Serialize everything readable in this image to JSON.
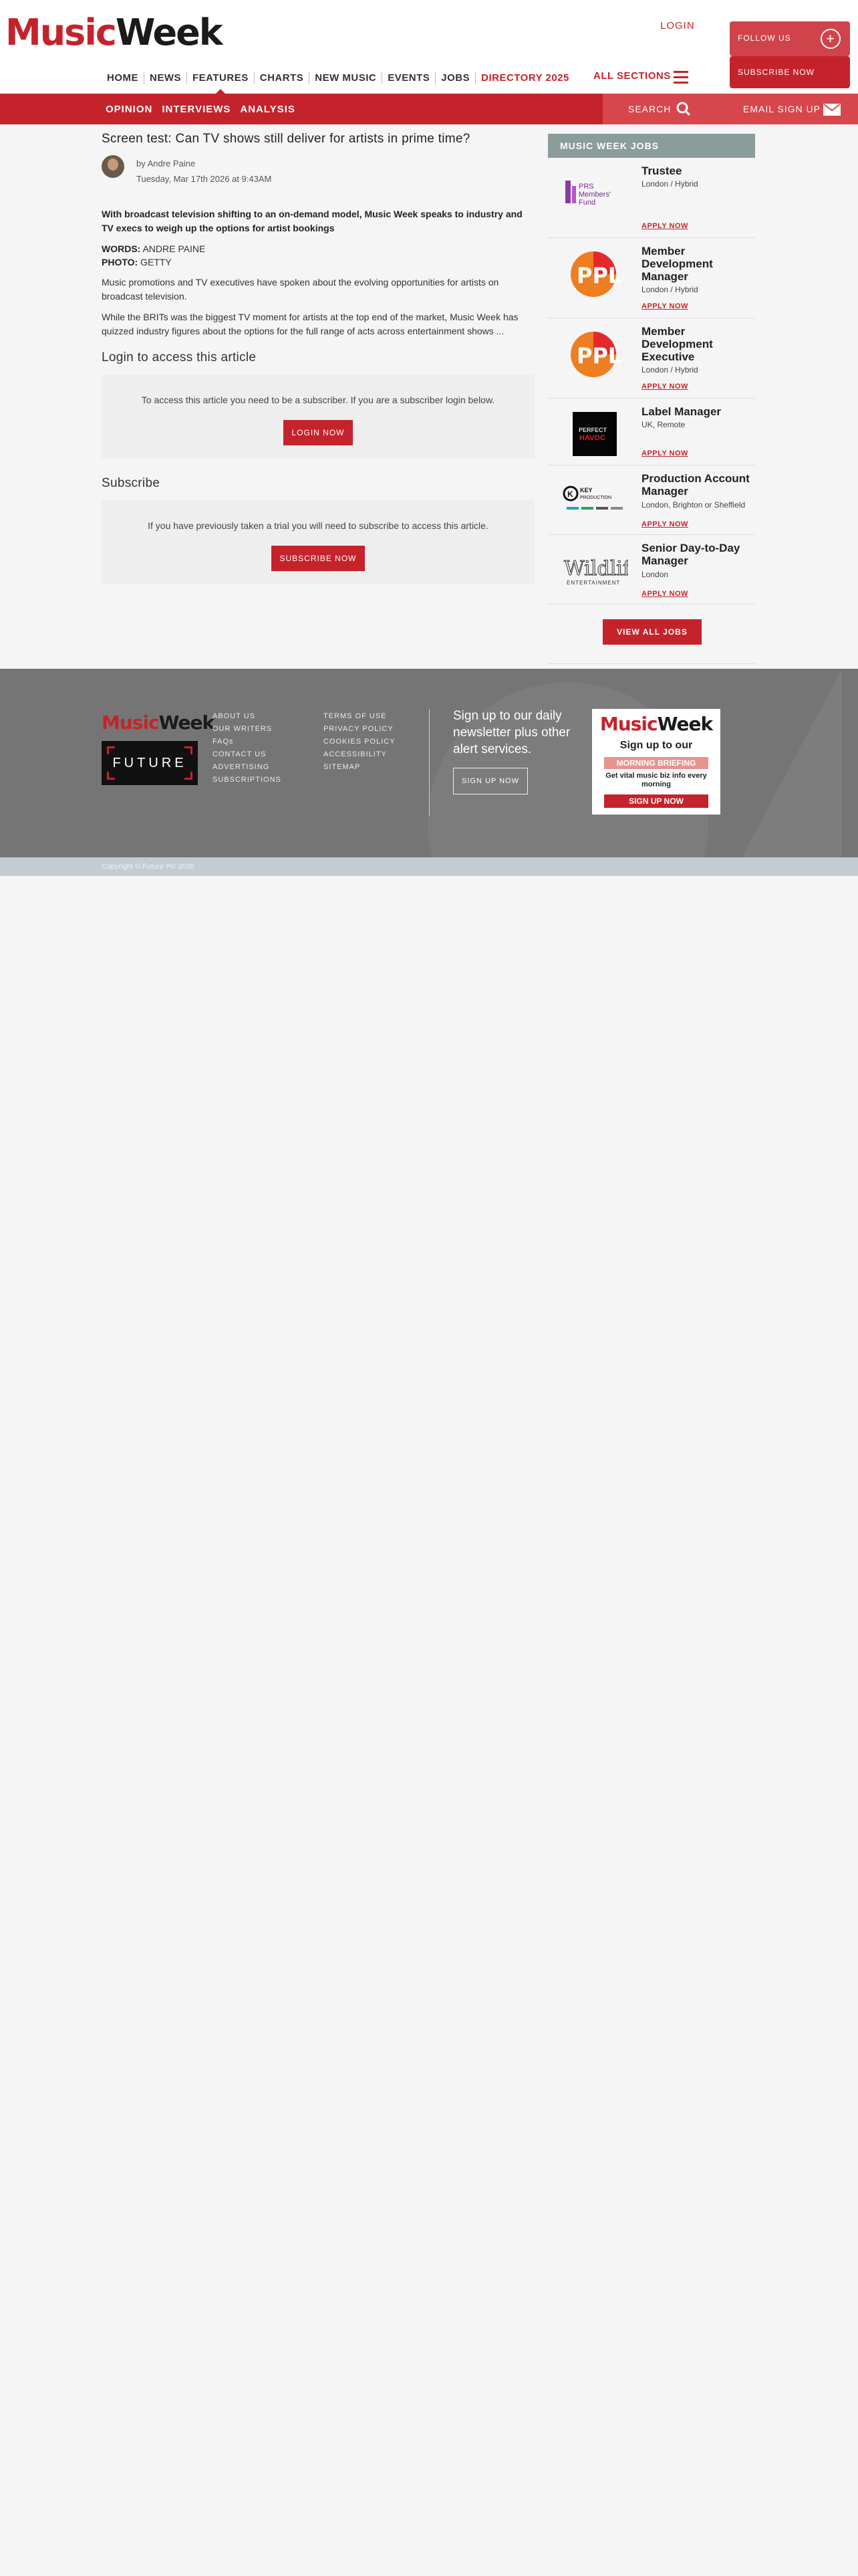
{
  "header": {
    "logo_part1": "Music",
    "logo_part2": "Week",
    "login": "LOGIN",
    "follow_us": "FOLLOW US",
    "subscribe_now": "SUBSCRIBE NOW",
    "all_sections": "ALL SECTIONS",
    "nav": [
      "HOME",
      "NEWS",
      "FEATURES",
      "CHARTS",
      "NEW MUSIC",
      "EVENTS",
      "JOBS",
      "DIRECTORY 2025"
    ]
  },
  "subbar": {
    "items": [
      "OPINION",
      "INTERVIEWS",
      "ANALYSIS"
    ],
    "search": "SEARCH",
    "email_signup": "EMAIL SIGN UP"
  },
  "article": {
    "title": "Screen test: Can TV shows still deliver for artists in prime time?",
    "author": "by Andre Paine",
    "date": "Tuesday, Mar 17th 2026 at 9:43AM",
    "standfirst": "With broadcast television shifting to an on-demand model, Music Week speaks to industry and TV execs to weigh up the options for artist bookings",
    "words_label": "WORDS:",
    "words_value": "ANDRE PAINE",
    "photo_label": "PHOTO:",
    "photo_value": "GETTY",
    "para1": "Music promotions and TV executives have spoken about the evolving opportunities for artists on broadcast television.",
    "para2": "While the BRITs was the biggest TV moment for artists at the top end of the market, Music Week has quizzed industry figures about the options for the full range of acts across entertainment shows ...",
    "login_heading": "Login to access this article",
    "login_text": "To access this article you need to be a subscriber. If you are a subscriber login below.",
    "login_button": "LOGIN NOW",
    "subscribe_heading": "Subscribe",
    "subscribe_text": "If you have previously taken a trial you will need to subscribe to access this article.",
    "subscribe_button": "SUBSCRIBE NOW"
  },
  "jobs": {
    "heading": "MUSIC WEEK JOBS",
    "items": [
      {
        "title": "Trustee",
        "location": "London / Hybrid",
        "apply": "APPLY NOW",
        "logo_text": "PRS Members' Fund"
      },
      {
        "title": "Member Development Manager",
        "location": "London / Hybrid",
        "apply": "APPLY NOW",
        "logo_text": "PPL"
      },
      {
        "title": "Member Development Executive",
        "location": "London / Hybrid",
        "apply": "APPLY NOW",
        "logo_text": "PPL"
      },
      {
        "title": "Label Manager",
        "location": "UK, Remote",
        "apply": "APPLY NOW",
        "logo_text": "PERFECT HAVOC"
      },
      {
        "title": "Production Account Manager",
        "location": "London, Brighton or Sheffield",
        "apply": "APPLY NOW",
        "logo_text": "KEY PRODUCTION"
      },
      {
        "title": "Senior Day-to-Day Manager",
        "location": "London",
        "apply": "APPLY NOW",
        "logo_text": "Wildlife ENTERTAINMENT"
      }
    ],
    "view_all": "VIEW ALL JOBS"
  },
  "footer": {
    "logo_part1": "Music",
    "logo_part2": "Week",
    "future": "FUTURE",
    "col1": [
      "ABOUT US",
      "OUR WRITERS",
      "FAQs",
      "CONTACT US",
      "ADVERTISING",
      "SUBSCRIPTIONS"
    ],
    "col2": [
      "TERMS OF USE",
      "PRIVACY POLICY",
      "COOKIES POLICY",
      "ACCESSIBILITY",
      "SITEMAP"
    ],
    "signup_text": "Sign up to our daily newsletter plus other alert services.",
    "signup_button": "SIGN UP NOW",
    "promo": {
      "logo_part1": "Music",
      "logo_part2": "Week",
      "signup": "Sign up to our",
      "band": "MORNING BRIEFING",
      "tagline": "Get vital music biz info every morning",
      "button": "SIGN UP NOW"
    },
    "copyright": "Copyright © Future Plc 2026"
  },
  "colors": {
    "brand_red": "#c5232c",
    "jobs_header": "#8b9d9a",
    "footer_bg": "#757575",
    "apply_red": "#c5232c"
  }
}
